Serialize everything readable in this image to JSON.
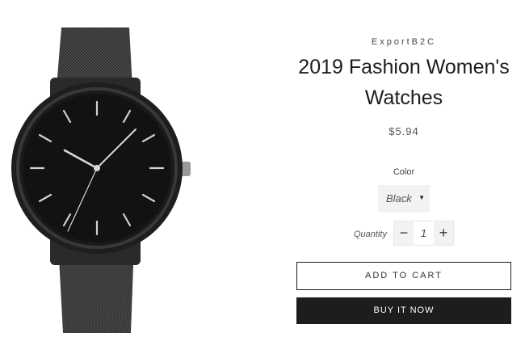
{
  "product": {
    "vendor": "ExportB2C",
    "title": "2019 Fashion Women's Watches",
    "price": "$5.94",
    "image_subject": "black mesh strap wristwatch",
    "color_label": "Color",
    "color_selected": "Black",
    "quantity_label": "Quantity",
    "quantity_value": "1",
    "minus_symbol": "−",
    "plus_symbol": "+",
    "caret_symbol": "▼",
    "add_to_cart": "ADD TO CART",
    "buy_now": "BUY IT NOW"
  },
  "colors": {
    "primary": "#1c1d1d",
    "background": "#ffffff",
    "field_bg": "#f2f2f2"
  }
}
